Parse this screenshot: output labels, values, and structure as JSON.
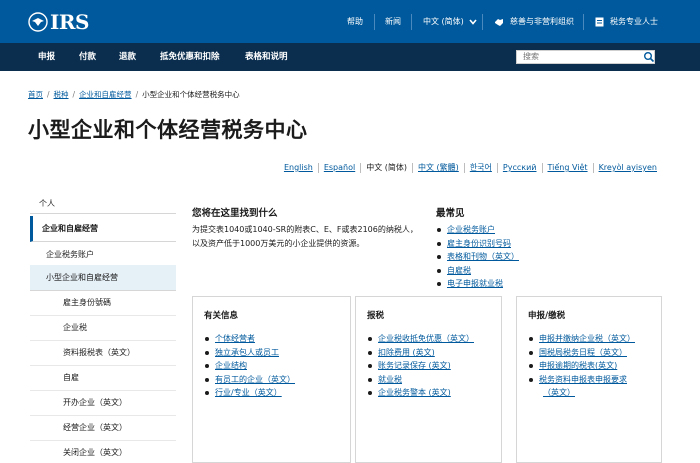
{
  "header": {
    "logo_text": "IRS",
    "utility": {
      "help": "帮助",
      "news": "新闻",
      "language": "中文 (简体)",
      "charities": "慈善与非营利组织",
      "tax_pros": "税务专业人士"
    }
  },
  "nav": {
    "items": [
      "申报",
      "付款",
      "退款",
      "抵免优惠和扣除",
      "表格和说明"
    ],
    "search_placeholder": "搜索"
  },
  "breadcrumb": {
    "items": [
      "首页",
      "税种",
      "企业和自雇经营"
    ],
    "current": "小型企业和个体经营税务中心"
  },
  "page_title": "小型企业和个体经营税务中心",
  "languages": [
    "English",
    "Español",
    "中文 (简体)",
    "中文 (繁體)",
    "한국어",
    "Русский",
    "Tiếng Việt",
    "Kreyòl ayisyen"
  ],
  "sidebar": {
    "items": [
      "个人",
      "企业和自雇经营",
      "企业税务账户",
      "小型企业和自雇经营",
      "雇主身份號碼",
      "企业税",
      "资料报税表（英文）",
      "自雇",
      "开办企业（英文）",
      "经营企业（英文）",
      "关闭企业（英文）"
    ]
  },
  "find": {
    "heading": "您将在这里找到什么",
    "text": "为提交表1040或1040-SR的附表C、E、F或表2106的纳税人，以及资产低于1000万美元的小企业提供的资源。"
  },
  "popular": {
    "heading": "最常见",
    "links": [
      "企业税务账户",
      "雇主身份识别号码",
      "表格和刊物（英文）",
      "自雇税",
      "电子申报就业税"
    ]
  },
  "cards": [
    {
      "title": "有关信息",
      "links": [
        "个体经营者",
        "独立承包人或员工",
        "企业结构",
        "有员工的企业（英文）",
        "行业/专业（英文）"
      ]
    },
    {
      "title": "报税",
      "links": [
        "企业税收抵免优惠（英文）",
        "扣除费用 (英文)",
        "账务记录保存 (英文)",
        "就业税",
        "企业税务警本 (英文)"
      ]
    },
    {
      "title": "申报/缴税",
      "links": [
        "申报并缴纳企业税（英文）",
        "国税局税务日程（英文）",
        "申报逾期的税表(英文)",
        "税务资料申报表申报要求",
        "（英文）"
      ]
    }
  ],
  "colors": {
    "brand_blue": "#00599c",
    "nav_dark": "#0b2e4f",
    "highlight": "#e6f0f7"
  }
}
